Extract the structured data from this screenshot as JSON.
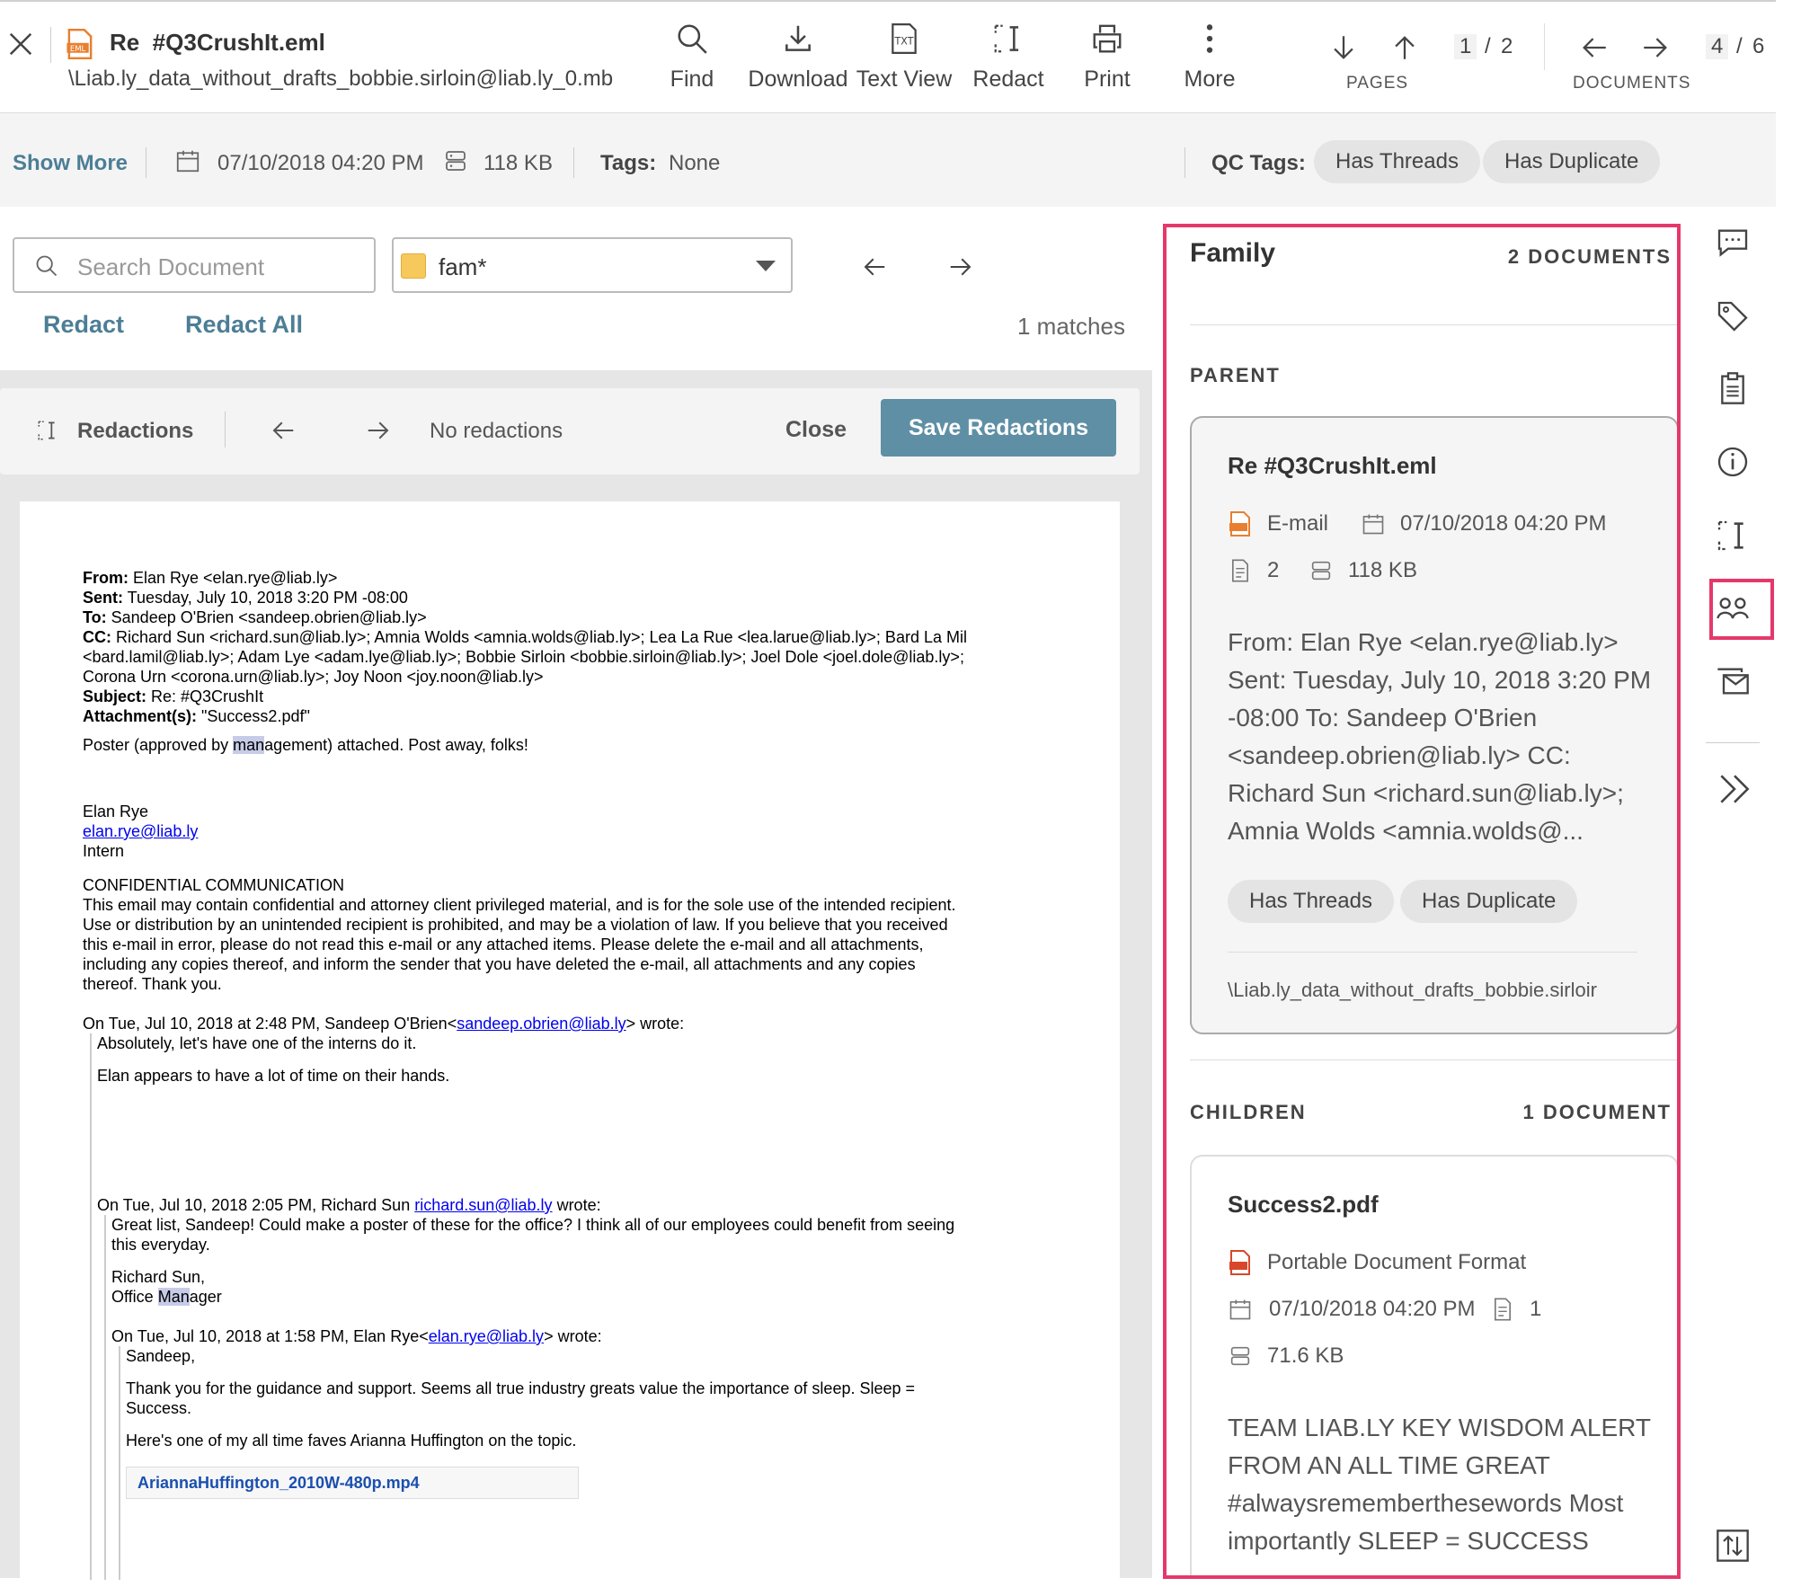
{
  "header": {
    "file_name": "Re  #Q3CrushIt.eml",
    "file_path": "\\Liab.ly_data_without_drafts_bobbie.sirloin@liab.ly_0.mb",
    "toolbar": {
      "find": "Find",
      "download": "Download",
      "text_view": "Text View",
      "redact": "Redact",
      "print": "Print",
      "more": "More"
    },
    "pages": {
      "current": "1",
      "separator": "/",
      "total": "2",
      "label": "PAGES"
    },
    "documents": {
      "current": "4",
      "separator": "/",
      "total": "6",
      "label": "DOCUMENTS"
    }
  },
  "infobar": {
    "show_more": "Show More",
    "date": "07/10/2018 04:20 PM",
    "size": "118 KB",
    "tags_label": "Tags:",
    "tags_value": "None",
    "qc_tags_label": "QC Tags:",
    "qc_tags": [
      "Has Threads",
      "Has Duplicate"
    ]
  },
  "search": {
    "placeholder": "Search Document",
    "filter_value": "fam*",
    "redact": "Redact",
    "redact_all": "Redact All",
    "matches": "1 matches"
  },
  "redactions": {
    "label": "Redactions",
    "status": "No redactions",
    "close": "Close",
    "save": "Save Redactions"
  },
  "document": {
    "from_label": "From:",
    "from": " Elan Rye <elan.rye@liab.ly>",
    "sent_label": "Sent:",
    "sent": " Tuesday, July 10, 2018 3:20 PM -08:00",
    "to_label": "To:",
    "to": " Sandeep O'Brien <sandeep.obrien@liab.ly>",
    "cc_label": "CC:",
    "cc1": " Richard Sun <richard.sun@liab.ly>; Amnia Wolds <amnia.wolds@liab.ly>; Lea La Rue <lea.larue@liab.ly>; Bard La Mil",
    "cc2": "<bard.lamil@liab.ly>; Adam Lye <adam.lye@liab.ly>; Bobbie Sirloin <bobbie.sirloin@liab.ly>; Joel Dole <joel.dole@liab.ly>;",
    "cc3": "Corona Urn <corona.urn@liab.ly>; Joy Noon <joy.noon@liab.ly>",
    "subject_label": "Subject:",
    "subject": " Re: #Q3CrushIt",
    "attach_label": "Attachment(s):",
    "attach": " \"Success2.pdf\"",
    "body1a": "Poster (approved by ",
    "body1hl": "man",
    "body1b": "agement) attached. Post away, folks!",
    "sig_name": "Elan Rye",
    "sig_email": "elan.rye@liab.ly",
    "sig_title": "Intern",
    "conf_title": "CONFIDENTIAL COMMUNICATION",
    "conf1": "This email may contain confidential and attorney client privileged material, and is for the sole use of the intended recipient.",
    "conf2": "Use or distribution by an unintended recipient is prohibited, and may be a violation of law. If you believe that you received",
    "conf3": "this e-mail in error, please do not read this e-mail or any attached items. Please delete the e-mail and all attachments,",
    "conf4": "including any copies thereof, and inform the sender that you have deleted the e-mail, all attachments and any copies",
    "conf5": "thereof. Thank you.",
    "q1_head_a": "On Tue, Jul 10, 2018 at 2:48 PM, Sandeep O'Brien<",
    "q1_head_link": "sandeep.obrien@liab.ly",
    "q1_head_b": "> wrote:",
    "q1_line1": "Absolutely, let's have one of the interns do it.",
    "q1_line2": "Elan appears to have a lot of time on their hands.",
    "q2_head_a": "On Tue, Jul 10, 2018 2:05 PM, Richard Sun ",
    "q2_head_link": "richard.sun@liab.ly",
    "q2_head_b": " wrote:",
    "q2_line1": "Great list, Sandeep! Could make a poster of these for the office? I think all of our employees could benefit from seeing",
    "q2_line2": "this everyday.",
    "q2_sig1": "Richard Sun,",
    "q2_sig2a": "Office ",
    "q2_sig2hl": "Man",
    "q2_sig2b": "ager",
    "q3_head_a": "On Tue, Jul 10, 2018 at 1:58 PM, Elan Rye<",
    "q3_head_link": "elan.rye@liab.ly",
    "q3_head_b": "> wrote:",
    "q3_line1": "Sandeep,",
    "q3_line2": "Thank you for the guidance and support. Seems all true industry greats value the importance of sleep. Sleep =",
    "q3_line3": "Success.",
    "q3_line4": "Here's one of my all time faves Arianna Huffington on the topic.",
    "attachment_link": "AriannaHuffington_2010W-480p.mp4"
  },
  "family": {
    "title": "Family",
    "count": "2 DOCUMENTS",
    "parent_label": "PARENT",
    "parent": {
      "title": "Re #Q3CrushIt.eml",
      "type": "E-mail",
      "date": "07/10/2018 04:20 PM",
      "pages": "2",
      "size": "118 KB",
      "preview": [
        "From: Elan Rye <elan.rye@liab.ly>",
        "Sent: Tuesday, July 10, 2018 3:20 PM",
        "-08:00 To: Sandeep O'Brien",
        "<sandeep.obrien@liab.ly> CC:",
        "Richard Sun <richard.sun@liab.ly>;",
        "Amnia Wolds <amnia.wolds@..."
      ],
      "tags": [
        "Has Threads",
        "Has Duplicate"
      ],
      "path": "\\Liab.ly_data_without_drafts_bobbie.sirloir"
    },
    "children_label": "CHILDREN",
    "children_count": "1 DOCUMENT",
    "child": {
      "title": "Success2.pdf",
      "type": "Portable Document Format",
      "date": "07/10/2018 04:20 PM",
      "pages": "1",
      "size": "71.6 KB",
      "preview": [
        "TEAM LIAB.LY KEY WISDOM ALERT",
        "FROM AN ALL TIME GREAT",
        "#alwaysrememberthesewords Most",
        "importantly SLEEP = SUCCESS"
      ]
    }
  },
  "colors": {
    "accent": "#4c7e96",
    "save_button": "#5f8fa5",
    "highlight_border": "#e5386a",
    "folder_yellow": "#f7c95c",
    "eml_orange": "#e87f2e",
    "pdf_red": "#d9472b"
  },
  "icons": [
    "close-icon",
    "eml-file-icon",
    "search-icon",
    "download-icon",
    "txt-icon",
    "redact-icon",
    "print-icon",
    "more-icon",
    "arrow-down-icon",
    "arrow-up-icon",
    "arrow-left-icon",
    "arrow-right-icon",
    "calendar-icon",
    "storage-icon",
    "chevron-down-icon",
    "comment-icon",
    "tag-icon",
    "clipboard-icon",
    "info-icon",
    "family-icon",
    "mail-icon",
    "double-chevron-icon",
    "sort-icon"
  ]
}
